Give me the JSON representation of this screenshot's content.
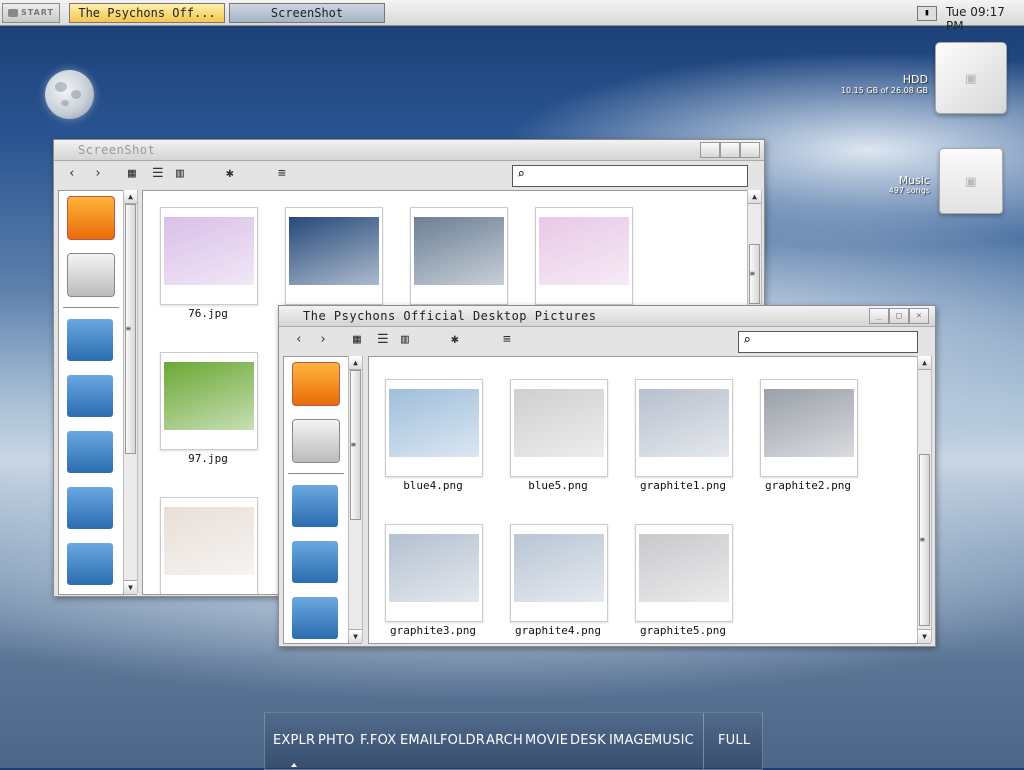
{
  "taskbar": {
    "start_label": "START",
    "tasks": [
      {
        "label": "The Psychons Off..."
      },
      {
        "label": "ScreenShot"
      }
    ],
    "clock": "Tue 09:17 PM"
  },
  "desktop": {
    "hdd": {
      "label": "HDD",
      "sub": "10.15 GB of 26.08 GB"
    },
    "music": {
      "label": "Music",
      "sub": "497 songs"
    }
  },
  "windows": {
    "screenshot": {
      "title": "ScreenShot",
      "files": [
        {
          "name": "76.jpg",
          "color": "#d9bfe8"
        },
        {
          "name": "",
          "color": "#25497a"
        },
        {
          "name": "",
          "color": "#6b7f95"
        },
        {
          "name": "",
          "color": "#e8c8e6"
        },
        {
          "name": "97.jpg",
          "color": "#6aa834"
        },
        {
          "name": "",
          "color": "#e8dfd8"
        }
      ]
    },
    "psychons": {
      "title": "The Psychons Official Desktop Pictures",
      "files": [
        {
          "name": "blue4.png",
          "color": "#9fbedb"
        },
        {
          "name": "blue5.png",
          "color": "#cfcfcf"
        },
        {
          "name": "graphite1.png",
          "color": "#b8c0ce"
        },
        {
          "name": "graphite2.png",
          "color": "#9aa0a8"
        },
        {
          "name": "graphite3.png",
          "color": "#b4c0d0"
        },
        {
          "name": "graphite4.png",
          "color": "#b9c5d4"
        },
        {
          "name": "graphite5.png",
          "color": "#c9c9cc"
        }
      ]
    }
  },
  "dock": {
    "items": [
      "EXPLR",
      "PHTO",
      "F.FOX",
      "EMAIL",
      "FOLDR",
      "ARCH",
      "MOVIE",
      "DESK",
      "IMAGE",
      "MUSIC"
    ],
    "full_label": "FULL"
  }
}
